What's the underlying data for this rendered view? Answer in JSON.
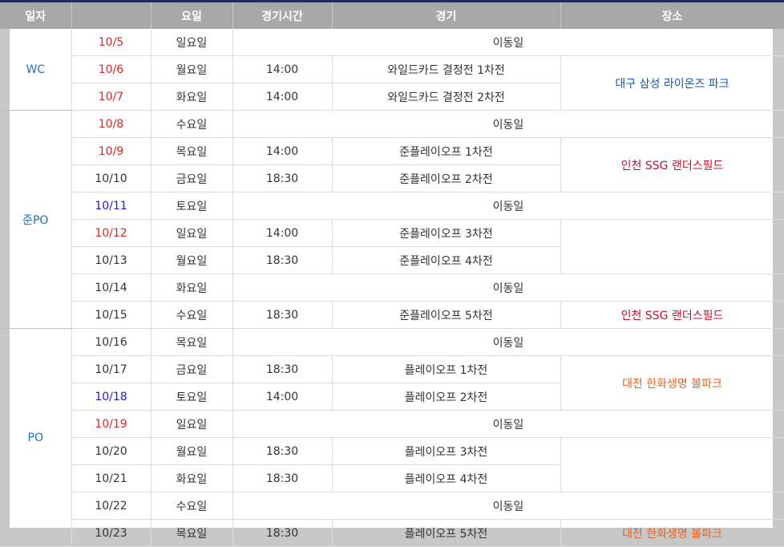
{
  "header": {
    "date": "일자",
    "day": "요일",
    "time": "경기시간",
    "game": "경기",
    "venue": "장소"
  },
  "phases": {
    "wc": "WC",
    "jun": "준PO",
    "po": "PO"
  },
  "rows": [
    {
      "date": "10/5",
      "day": "일요일",
      "time": "",
      "game": "이동일",
      "date_color": "red"
    },
    {
      "date": "10/6",
      "day": "월요일",
      "time": "14:00",
      "game": "와일드카드 결정전 1차전",
      "date_color": "red"
    },
    {
      "date": "10/7",
      "day": "화요일",
      "time": "14:00",
      "game": "와일드카드 결정전 2차전",
      "date_color": "red"
    },
    {
      "date": "10/8",
      "day": "수요일",
      "time": "",
      "game": "이동일",
      "date_color": "red"
    },
    {
      "date": "10/9",
      "day": "목요일",
      "time": "14:00",
      "game": "준플레이오프 1차전",
      "date_color": "red"
    },
    {
      "date": "10/10",
      "day": "금요일",
      "time": "18:30",
      "game": "준플레이오프 2차전",
      "date_color": "dark"
    },
    {
      "date": "10/11",
      "day": "토요일",
      "time": "",
      "game": "이동일",
      "date_color": "blue"
    },
    {
      "date": "10/12",
      "day": "일요일",
      "time": "14:00",
      "game": "준플레이오프 3차전",
      "date_color": "red"
    },
    {
      "date": "10/13",
      "day": "월요일",
      "time": "18:30",
      "game": "준플레이오프 4차전",
      "date_color": "dark"
    },
    {
      "date": "10/14",
      "day": "화요일",
      "time": "",
      "game": "이동일",
      "date_color": "dark"
    },
    {
      "date": "10/15",
      "day": "수요일",
      "time": "18:30",
      "game": "준플레이오프 5차전",
      "date_color": "dark"
    },
    {
      "date": "10/16",
      "day": "목요일",
      "time": "",
      "game": "이동일",
      "date_color": "dark"
    },
    {
      "date": "10/17",
      "day": "금요일",
      "time": "18:30",
      "game": "플레이오프 1차전",
      "date_color": "dark"
    },
    {
      "date": "10/18",
      "day": "토요일",
      "time": "14:00",
      "game": "플레이오프 2차전",
      "date_color": "blue"
    },
    {
      "date": "10/19",
      "day": "일요일",
      "time": "",
      "game": "이동일",
      "date_color": "red"
    },
    {
      "date": "10/20",
      "day": "월요일",
      "time": "18:30",
      "game": "플레이오프 3차전",
      "date_color": "dark"
    },
    {
      "date": "10/21",
      "day": "화요일",
      "time": "18:30",
      "game": "플레이오프 4차전",
      "date_color": "dark"
    },
    {
      "date": "10/22",
      "day": "수요일",
      "time": "",
      "game": "이동일",
      "date_color": "dark"
    },
    {
      "date": "10/23",
      "day": "목요일",
      "time": "18:30",
      "game": "플레이오프 5차전",
      "date_color": "dark"
    }
  ],
  "venues": {
    "daegu": "대구 삼성 라이온즈 파크",
    "incheon_1": "인천 SSG 랜더스필드",
    "incheon_2": "인천 SSG 랜더스필드",
    "daejeon_1": "대전 한화생명 볼파크",
    "daejeon_2": "대전 한화생명 볼파크"
  },
  "colors": {
    "red": "#e02424",
    "blue": "#1a1ad6",
    "phase": "#1f6fb8",
    "header_bg": "#a8a8a8",
    "backdrop": "#c8c8c8"
  }
}
